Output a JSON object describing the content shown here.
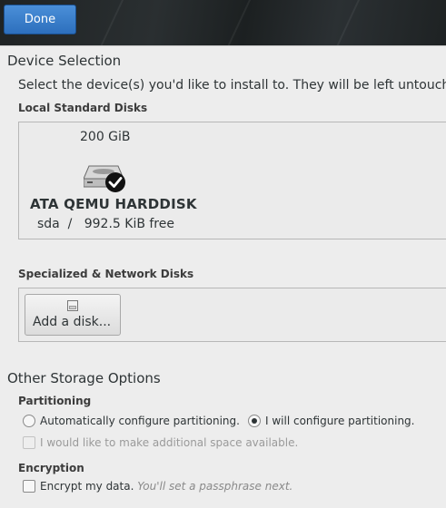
{
  "header": {
    "done_label": "Done"
  },
  "device_selection": {
    "title": "Device Selection",
    "instruction": "Select the device(s) you'd like to install to.  They will be left untouched"
  },
  "local_disks": {
    "label": "Local Standard Disks",
    "disks": [
      {
        "size": "200 GiB",
        "name": "ATA QEMU HARDDISK",
        "free": "sda  /   992.5 KiB free",
        "selected": true
      }
    ]
  },
  "specialized": {
    "label": "Specialized & Network Disks",
    "add_label": "Add a disk..."
  },
  "other_storage": {
    "title": "Other Storage Options",
    "partitioning": {
      "label": "Partitioning",
      "auto_label": "Automatically configure partitioning.",
      "manual_label": "I will configure partitioning.",
      "selected": "manual",
      "extra_space_label": "I would like to make additional space available."
    },
    "encryption": {
      "label": "Encryption",
      "encrypt_label": "Encrypt my data.",
      "encrypt_hint": "You'll set a passphrase next."
    }
  },
  "colors": {
    "accent": "#2d6fbd",
    "background": "#ededed",
    "topbar": "#252a2b"
  },
  "icons": {
    "disk": "harddisk-icon",
    "selected": "checkmark-badge-icon",
    "add": "add-disk-icon"
  }
}
